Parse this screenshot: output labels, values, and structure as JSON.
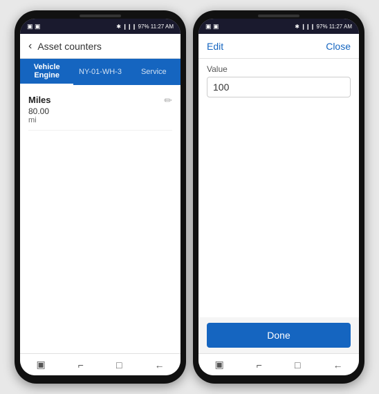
{
  "phone1": {
    "statusBar": {
      "left": "▣ ▣",
      "right": "✱  ❙❙❙ 97%  11:27 AM"
    },
    "header": {
      "backLabel": "‹",
      "title": "Asset counters"
    },
    "tabs": [
      {
        "id": "vehicle-engine",
        "label": "Vehicle Engine",
        "active": true
      },
      {
        "id": "ny-01-wh-3",
        "label": "NY-01-WH-3",
        "active": false
      },
      {
        "id": "service",
        "label": "Service",
        "active": false
      }
    ],
    "row": {
      "label": "Miles",
      "value": "80.00",
      "unit": "mi"
    },
    "bottomNav": [
      "▣",
      "⌐",
      "□",
      "←"
    ]
  },
  "phone2": {
    "statusBar": {
      "left": "▣ ▣",
      "right": "✱  ❙❙❙ 97%  11:27 AM"
    },
    "header": {
      "editLabel": "Edit",
      "closeLabel": "Close"
    },
    "valueLabel": "Value",
    "valueInput": "100",
    "doneButton": "Done",
    "bottomNav": [
      "▣",
      "⌐",
      "□",
      "←"
    ]
  }
}
